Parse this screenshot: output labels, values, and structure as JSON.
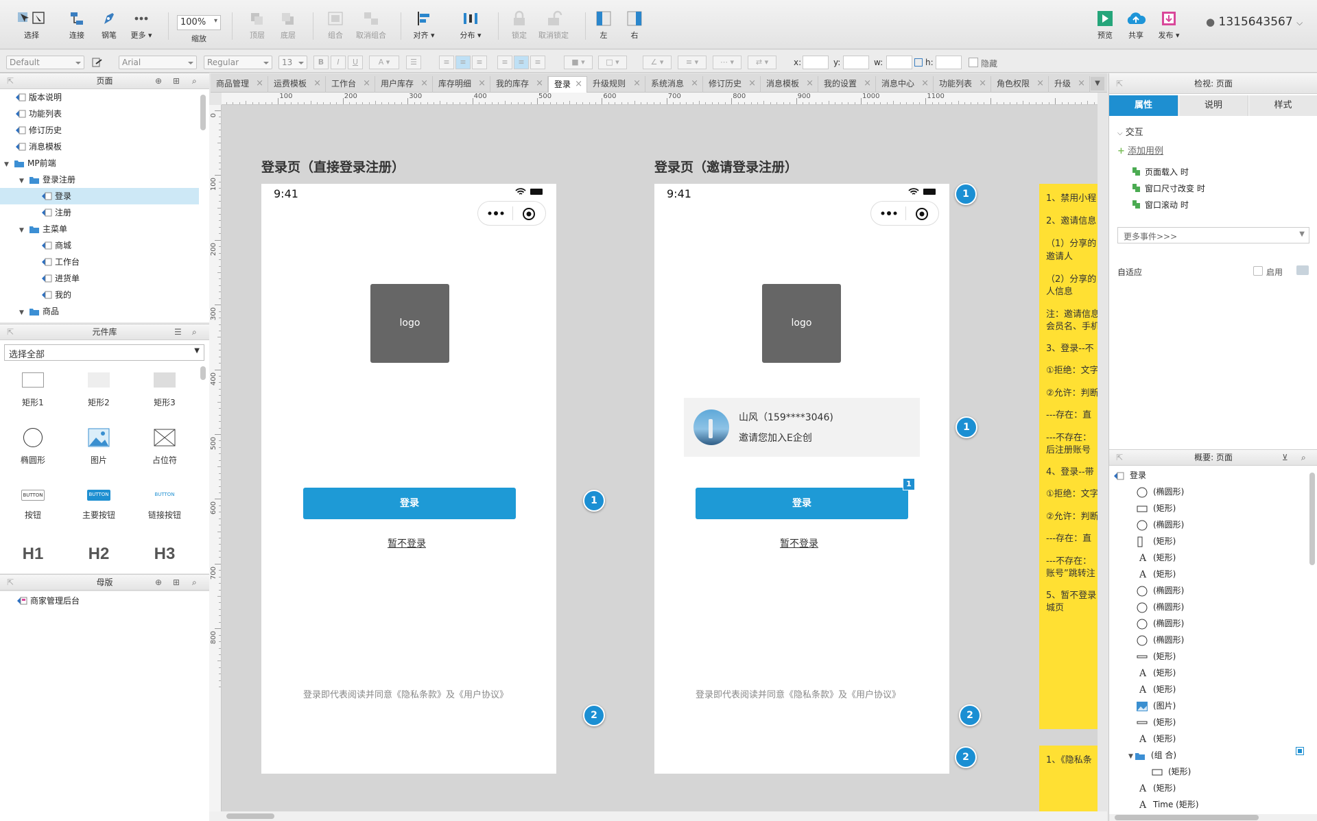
{
  "toolbar": {
    "select": "选择",
    "connect": "连接",
    "pen": "钢笔",
    "more": "更多",
    "zoom_value": "100%",
    "zoom_label": "缩放",
    "top": "顶层",
    "bottom": "底层",
    "group": "组合",
    "ungroup": "取消组合",
    "align": "对齐",
    "distribute": "分布",
    "lock": "锁定",
    "unlock": "取消锁定",
    "left": "左",
    "right": "右",
    "preview": "预览",
    "share": "共享",
    "publish": "发布",
    "user": "1315643567"
  },
  "format_bar": {
    "style": "Default",
    "font": "Arial",
    "weight": "Regular",
    "size": "13",
    "x_label": "x:",
    "y_label": "y:",
    "w_label": "w:",
    "h_label": "h:",
    "hidden_label": "隐藏"
  },
  "pages_panel": {
    "title": "页面",
    "items": [
      {
        "label": "版本说明"
      },
      {
        "label": "功能列表"
      },
      {
        "label": "修订历史"
      },
      {
        "label": "消息模板"
      },
      {
        "label": "MP前端"
      },
      {
        "label": "登录注册"
      },
      {
        "label": "登录"
      },
      {
        "label": "注册"
      },
      {
        "label": "主菜单"
      },
      {
        "label": "商城"
      },
      {
        "label": "工作台"
      },
      {
        "label": "进货单"
      },
      {
        "label": "我的"
      },
      {
        "label": "商品"
      }
    ]
  },
  "library_panel": {
    "title": "元件库",
    "filter": "选择全部",
    "items": [
      {
        "label": "矩形1"
      },
      {
        "label": "矩形2"
      },
      {
        "label": "矩形3"
      },
      {
        "label": "椭圆形"
      },
      {
        "label": "图片"
      },
      {
        "label": "占位符"
      },
      {
        "label": "按钮",
        "preview": "BUTTON"
      },
      {
        "label": "主要按钮",
        "preview": "BUTTON"
      },
      {
        "label": "链接按钮",
        "preview": "BUTTON"
      },
      {
        "label": "H1"
      },
      {
        "label": "H2"
      },
      {
        "label": "H3"
      }
    ]
  },
  "masters_panel": {
    "title": "母版",
    "items": [
      {
        "label": "商家管理后台"
      }
    ]
  },
  "tabs": [
    {
      "label": "商品管理"
    },
    {
      "label": "运费模板"
    },
    {
      "label": "工作台"
    },
    {
      "label": "用户库存"
    },
    {
      "label": "库存明细"
    },
    {
      "label": "我的库存"
    },
    {
      "label": "登录",
      "active": true
    },
    {
      "label": "升级规则"
    },
    {
      "label": "系统消息"
    },
    {
      "label": "修订历史"
    },
    {
      "label": "消息模板"
    },
    {
      "label": "我的设置"
    },
    {
      "label": "消息中心"
    },
    {
      "label": "功能列表"
    },
    {
      "label": "角色权限"
    },
    {
      "label": "升级"
    }
  ],
  "rulers": {
    "h": [
      "100",
      "200",
      "300",
      "400",
      "500",
      "600",
      "700",
      "800",
      "900",
      "1000",
      "1100"
    ],
    "v": [
      "0",
      "100",
      "200",
      "300",
      "400",
      "500",
      "600",
      "700",
      "800"
    ]
  },
  "canvas": {
    "phone1": {
      "title": "登录页（直接登录注册）",
      "time": "9:41",
      "logo": "logo",
      "login": "登录",
      "skip": "暂不登录",
      "terms": "登录即代表阅读并同意《隐私条款》及《用户协议》"
    },
    "phone2": {
      "title": "登录页（邀请登录注册）",
      "time": "9:41",
      "logo": "logo",
      "inviter": "山风（159****3046)",
      "invite_text": "邀请您加入E企创",
      "badge": "1",
      "login": "登录",
      "skip": "暂不登录",
      "terms": "登录即代表阅读并同意《隐私条款》及《用户协议》"
    },
    "markers": [
      "1",
      "2",
      "1",
      "2",
      "1",
      "2"
    ],
    "note1_lines": [
      "1、禁用小程",
      "2、邀请信息",
      "（1）分享的",
      "邀请人",
      "（2）分享的",
      "人信息",
      "注：邀请信息",
      "会员名、手机",
      "3、登录--不",
      "①拒绝：文字",
      "②允许：判断",
      "---存在：直",
      "---不存在：",
      "后注册账号",
      "4、登录--带",
      "①拒绝：文字",
      "②允许：判断",
      "---存在：直",
      "---不存在：",
      "账号”跳转注",
      "5、暂不登录",
      "城页"
    ],
    "note2_lines": [
      "1、《隐私条"
    ]
  },
  "inspector": {
    "title": "检视: 页面",
    "tabs": [
      "属性",
      "说明",
      "样式"
    ],
    "interaction": "交互",
    "add_case": "添加用例",
    "events": [
      "页面载入 时",
      "窗口尺寸改变 时",
      "窗口滚动 时"
    ],
    "more_events": "更多事件>>>",
    "adaptive": "自适应",
    "enable": "启用"
  },
  "outline": {
    "title": "概要: 页面",
    "root": "登录",
    "items": [
      {
        "label": "(椭圆形)",
        "icon": "ellipse"
      },
      {
        "label": "(矩形)",
        "icon": "rect"
      },
      {
        "label": "(椭圆形)",
        "icon": "ellipse"
      },
      {
        "label": "(矩形)",
        "icon": "vbar"
      },
      {
        "label": "(矩形)",
        "icon": "text"
      },
      {
        "label": "(矩形)",
        "icon": "text"
      },
      {
        "label": "(椭圆形)",
        "icon": "ellipse"
      },
      {
        "label": "(椭圆形)",
        "icon": "ellipse"
      },
      {
        "label": "(椭圆形)",
        "icon": "ellipse"
      },
      {
        "label": "(椭圆形)",
        "icon": "ellipse"
      },
      {
        "label": "(矩形)",
        "icon": "line"
      },
      {
        "label": "(矩形)",
        "icon": "text"
      },
      {
        "label": "(矩形)",
        "icon": "text"
      },
      {
        "label": "(图片)",
        "icon": "image"
      },
      {
        "label": "(矩形)",
        "icon": "line"
      },
      {
        "label": "(矩形)",
        "icon": "text"
      },
      {
        "label": "(组 合)",
        "icon": "folder"
      },
      {
        "label": "(矩形)",
        "icon": "rect"
      },
      {
        "label": "(矩形)",
        "icon": "text"
      },
      {
        "label": "Time (矩形)",
        "icon": "text"
      }
    ]
  },
  "colors": {
    "accent": "#1e9ad6",
    "note": "#ffe033",
    "marker": "#1b8fd3"
  }
}
